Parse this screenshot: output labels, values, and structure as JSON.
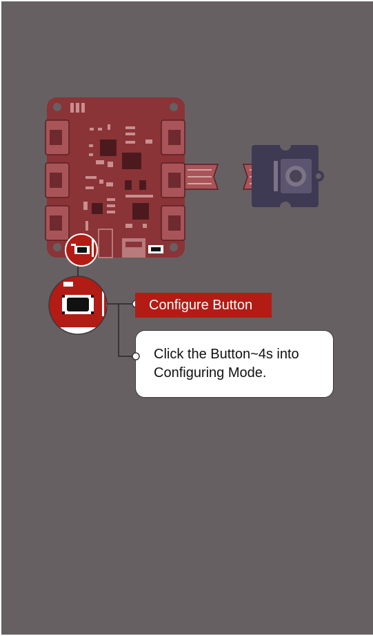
{
  "colors": {
    "background": "#666063",
    "board": "#8a3437",
    "board_detail": "#5a1e22",
    "module": "#3e3a54",
    "accent": "#b31b15",
    "callout_border": "#3d3739"
  },
  "label": {
    "text": "Configure Button"
  },
  "callout": {
    "line1": "Click the Button~4s into",
    "line2": "Configuring Mode."
  },
  "icons": {
    "board": "circuit-board-icon",
    "module": "button-module-icon",
    "zoom": "magnifier-zoom-icon"
  }
}
